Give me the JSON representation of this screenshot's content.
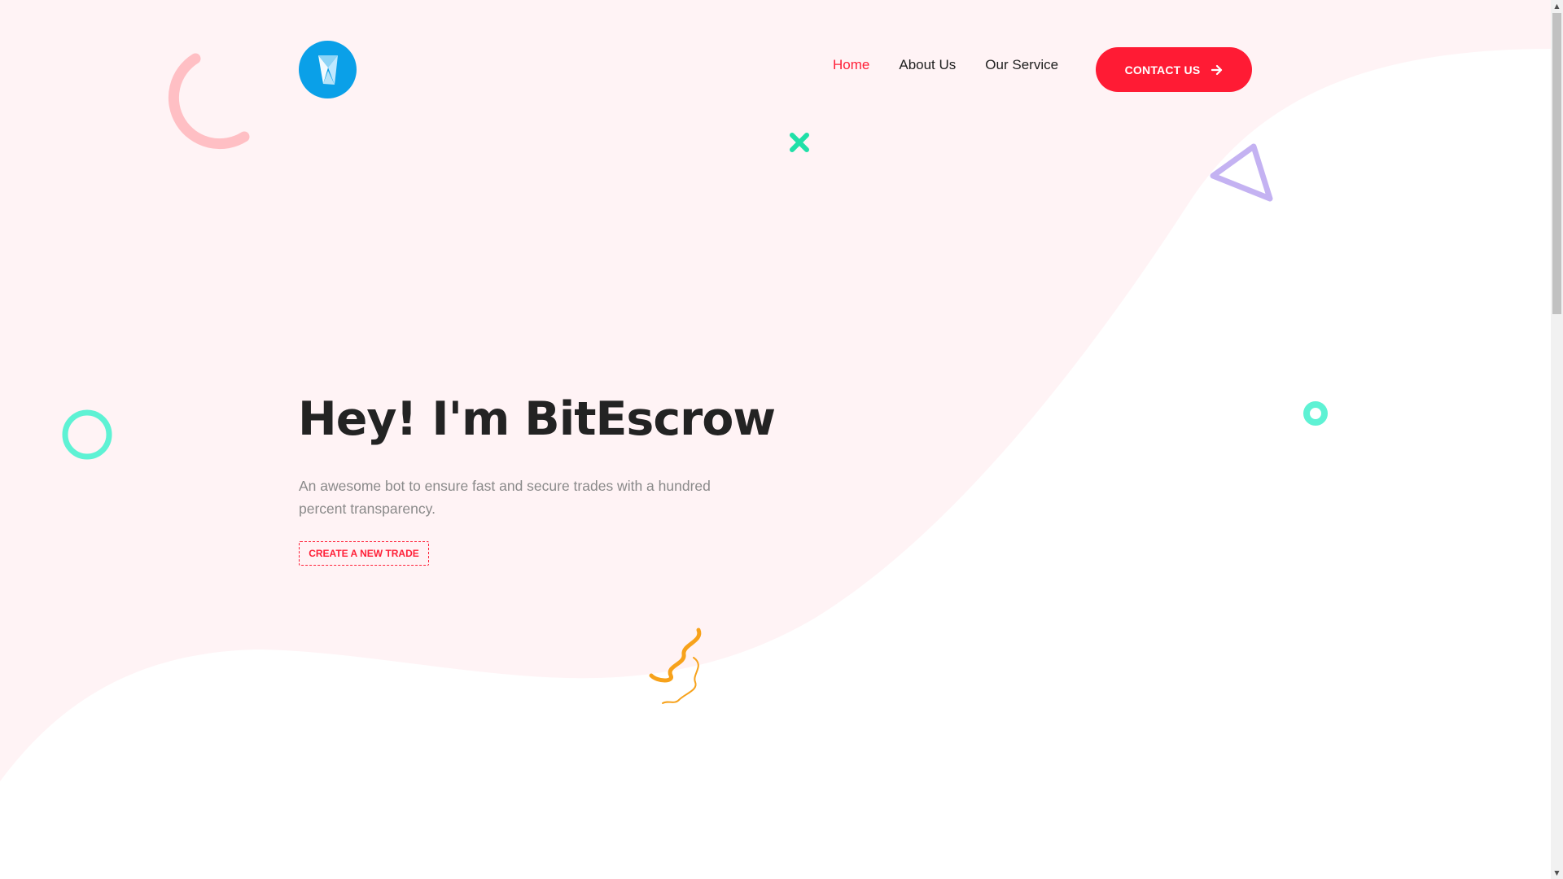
{
  "header": {
    "logo_icon": "hourglass-x-logo",
    "nav": [
      {
        "label": "Home",
        "active": true
      },
      {
        "label": "About Us",
        "active": false
      },
      {
        "label": "Our Service",
        "active": false
      }
    ],
    "contact_label": "CONTACT US",
    "contact_icon": "arrow-right-icon"
  },
  "hero": {
    "title": "Hey! I'm BitEscrow",
    "description": "An awesome bot to ensure fast and secure trades with a hundred percent transparency.",
    "cta_label": "CREATE A NEW TRADE"
  },
  "colors": {
    "accent": "#ff1b34",
    "background_tint": "#fff3f5",
    "logo": "#0aa0e8",
    "deco_pink": "#ffbfc4",
    "deco_teal": "#5ef2d4",
    "deco_purple": "#c4b2f2",
    "deco_orange": "#f7a21b",
    "deco_green": "#20e0a8"
  }
}
